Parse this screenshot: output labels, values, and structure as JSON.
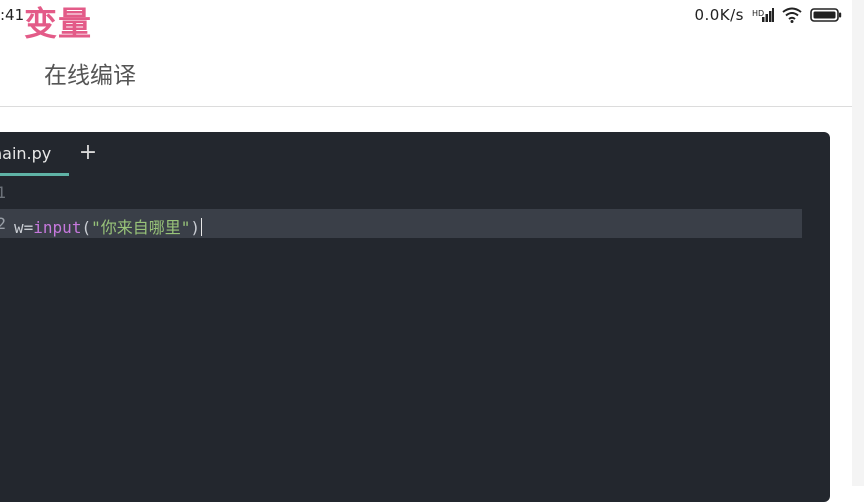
{
  "statusbar": {
    "time": ":41",
    "network_speed": "0.0K/s",
    "signal_icon": "signal-icon",
    "wifi_icon": "wifi-icon",
    "battery_icon": "battery-icon"
  },
  "overlay_title": "变量",
  "header": {
    "title": "在线编译"
  },
  "editor": {
    "tabs": [
      {
        "label": "nain.py",
        "active": true
      }
    ],
    "add_tab_label": "+",
    "lines": [
      {
        "number": "1",
        "code": ""
      },
      {
        "number": "2",
        "tokens": [
          "w",
          "=",
          "input",
          "(",
          "\"你来自哪里\"",
          ")"
        ]
      }
    ]
  },
  "colors": {
    "editor_bg": "#23272e",
    "active_line": "#3a3f48",
    "tab_accent": "#5fb3a6",
    "overlay_text": "#e35b88",
    "keyword_purple": "#c678dd",
    "string_green": "#98c379"
  }
}
